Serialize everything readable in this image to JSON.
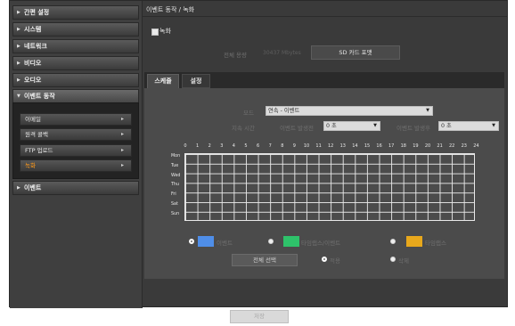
{
  "sidebar": {
    "items": [
      {
        "label": "간편 설정"
      },
      {
        "label": "시스템"
      },
      {
        "label": "네트워크"
      },
      {
        "label": "비디오"
      },
      {
        "label": "오디오"
      },
      {
        "label": "이벤트 동작"
      },
      {
        "label": "이벤트"
      }
    ],
    "subitems": [
      {
        "label": "이메일"
      },
      {
        "label": "원격 콜백"
      },
      {
        "label": "FTP 업로드"
      },
      {
        "label": "녹화"
      }
    ]
  },
  "content": {
    "title": "이벤트 동작 / 녹화",
    "record_checkbox_label": "녹화",
    "total_capacity_label": "전체 용량",
    "total_capacity_value": "30437 Mbytes",
    "sd_format_button": "SD 카드 포맷"
  },
  "tabs": [
    {
      "label": "스케줄"
    },
    {
      "label": "설정"
    }
  ],
  "schedule": {
    "mode_label": "모드",
    "mode_value": "연속 - 이벤트",
    "duration_label": "지속 시간",
    "pre_event_label": "이벤트 발생전",
    "pre_event_value": "0 초",
    "post_event_label": "이벤트 발생후",
    "post_event_value": "0 초",
    "hours": [
      "0",
      "1",
      "2",
      "3",
      "4",
      "5",
      "6",
      "7",
      "8",
      "9",
      "10",
      "11",
      "12",
      "13",
      "14",
      "15",
      "16",
      "17",
      "18",
      "19",
      "20",
      "21",
      "22",
      "23",
      "24"
    ],
    "days": [
      "Mon",
      "Tue",
      "Wed",
      "Thu",
      "Fri",
      "Sat",
      "Sun"
    ]
  },
  "legend": {
    "items": [
      {
        "label": "이벤트",
        "color": "#4f8ee8"
      },
      {
        "label": "타임랩스/이벤트",
        "color": "#2ec26a"
      },
      {
        "label": "타임랩스",
        "color": "#e8a81c"
      }
    ],
    "select_all_button": "전체 선택",
    "option_set": "적용",
    "option_clear": "삭제"
  },
  "footer": {
    "save_button": "저장"
  }
}
